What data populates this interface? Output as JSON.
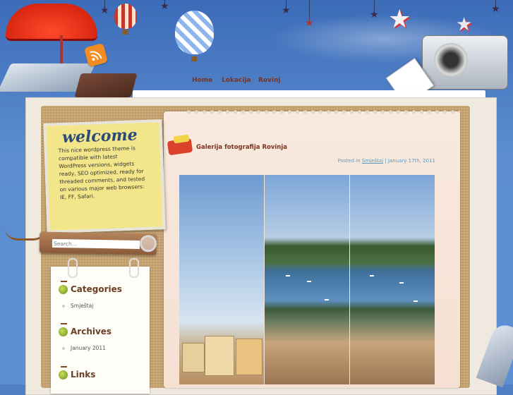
{
  "nav": {
    "items": [
      "Home",
      "Lokacija",
      "Rovinj"
    ]
  },
  "welcome": {
    "title": "welcome",
    "text": "This nice wordpress theme is compatible with latest WordPress versions, widgets ready, SEO optimized, ready for threaded comments, and tested on various major web browsers: IE, FF, Safari."
  },
  "search": {
    "placeholder": "Search..."
  },
  "sidebar": {
    "widgets": [
      {
        "title": "Categories",
        "links": [
          "Smještaj"
        ]
      },
      {
        "title": "Archives",
        "links": [
          "January 2011"
        ]
      },
      {
        "title": "Links",
        "links": []
      }
    ]
  },
  "post": {
    "title": "Galerija fotografija Rovinja",
    "posted_in": "Posted in",
    "category": "Smještaj",
    "separator": "|",
    "date": "January 17th, 2011"
  },
  "icons": {
    "rss": "rss-icon",
    "widget": "acorn-icon",
    "post": "photo-album-icon"
  },
  "colors": {
    "sky": "#4f7fc4",
    "nav_text": "#7a3320",
    "widget_title": "#6a3e22",
    "meta_link": "#5a9bbf",
    "note": "#f3e68a"
  }
}
